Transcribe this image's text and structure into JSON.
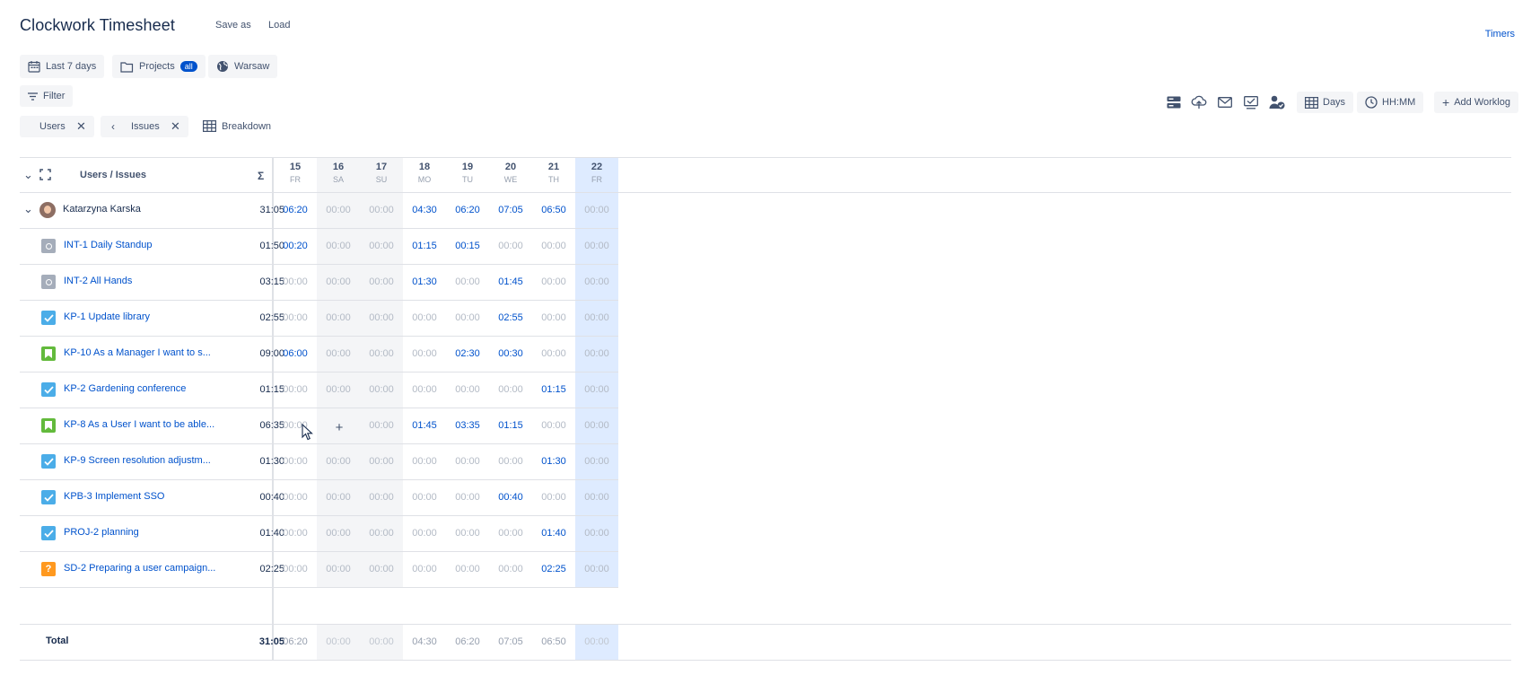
{
  "app": {
    "title": "Clockwork Timesheet",
    "save_as": "Save as",
    "load": "Load",
    "timers": "Timers"
  },
  "filters": {
    "period": "Last 7 days",
    "projects": "Projects",
    "projects_badge": "all",
    "timezone": "Warsaw",
    "filter": "Filter"
  },
  "grouping": {
    "users": "Users",
    "issues": "Issues",
    "breakdown": "Breakdown"
  },
  "toolbar": {
    "icons": [
      "server-icon",
      "cloud-upload-icon",
      "mail-icon",
      "report-icon",
      "user-check-icon"
    ],
    "days": "Days",
    "time_format": "HH:MM",
    "add_worklog": "Add Worklog"
  },
  "table": {
    "header": {
      "label": "Users / Issues",
      "sigma": "Σ"
    },
    "days": [
      {
        "num": "15",
        "dow": "FR"
      },
      {
        "num": "16",
        "dow": "SA"
      },
      {
        "num": "17",
        "dow": "SU"
      },
      {
        "num": "18",
        "dow": "MO"
      },
      {
        "num": "19",
        "dow": "TU"
      },
      {
        "num": "20",
        "dow": "WE"
      },
      {
        "num": "21",
        "dow": "TH"
      },
      {
        "num": "22",
        "dow": "FR"
      }
    ],
    "weekend_days": [
      1,
      2
    ],
    "today_day": 7,
    "user": {
      "name": "Katarzyna Karska",
      "total": "31:05",
      "values": [
        "06:20",
        "00:00",
        "00:00",
        "04:30",
        "06:20",
        "07:05",
        "06:50",
        "00:00"
      ]
    },
    "issues": [
      {
        "type": "task-gray",
        "label": "INT-1 Daily Standup",
        "total": "01:50",
        "values": [
          "00:20",
          "00:00",
          "00:00",
          "01:15",
          "00:15",
          "00:00",
          "00:00",
          "00:00"
        ]
      },
      {
        "type": "task-gray",
        "label": "INT-2 All Hands",
        "total": "03:15",
        "values": [
          "00:00",
          "00:00",
          "00:00",
          "01:30",
          "00:00",
          "01:45",
          "00:00",
          "00:00"
        ]
      },
      {
        "type": "task-blue",
        "label": "KP-1 Update library",
        "total": "02:55",
        "values": [
          "00:00",
          "00:00",
          "00:00",
          "00:00",
          "00:00",
          "02:55",
          "00:00",
          "00:00"
        ]
      },
      {
        "type": "story",
        "label": "KP-10 As a Manager I want to s...",
        "total": "09:00",
        "values": [
          "06:00",
          "00:00",
          "00:00",
          "00:00",
          "02:30",
          "00:30",
          "00:00",
          "00:00"
        ]
      },
      {
        "type": "task-blue",
        "label": "KP-2 Gardening conference",
        "total": "01:15",
        "values": [
          "00:00",
          "00:00",
          "00:00",
          "00:00",
          "00:00",
          "00:00",
          "01:15",
          "00:00"
        ]
      },
      {
        "type": "story",
        "label": "KP-8 As a User I want to be able...",
        "total": "06:35",
        "values": [
          "00:00",
          "",
          "00:00",
          "01:45",
          "03:35",
          "01:15",
          "00:00",
          "00:00"
        ]
      },
      {
        "type": "task-blue",
        "label": "KP-9 Screen resolution adjustm...",
        "total": "01:30",
        "values": [
          "00:00",
          "00:00",
          "00:00",
          "00:00",
          "00:00",
          "00:00",
          "01:30",
          "00:00"
        ]
      },
      {
        "type": "task-blue",
        "label": "KPB-3 Implement SSO",
        "total": "00:40",
        "values": [
          "00:00",
          "00:00",
          "00:00",
          "00:00",
          "00:00",
          "00:40",
          "00:00",
          "00:00"
        ]
      },
      {
        "type": "task-blue",
        "label": "PROJ-2 planning",
        "total": "01:40",
        "values": [
          "00:00",
          "00:00",
          "00:00",
          "00:00",
          "00:00",
          "00:00",
          "01:40",
          "00:00"
        ]
      },
      {
        "type": "question",
        "label": "SD-2 Preparing a user campaign...",
        "total": "02:25",
        "values": [
          "00:00",
          "00:00",
          "00:00",
          "00:00",
          "00:00",
          "00:00",
          "02:25",
          "00:00"
        ]
      }
    ],
    "footer": {
      "label": "Total",
      "total": "31:05",
      "values": [
        "06:20",
        "00:00",
        "00:00",
        "04:30",
        "06:20",
        "07:05",
        "06:50",
        "00:00"
      ]
    }
  },
  "colors": {
    "accent": "#0052cc",
    "muted": "#b3bac5",
    "weekend": "#f4f5f7",
    "today": "#deebff",
    "task_blue": "#4bade8",
    "task_gray": "#a5adba",
    "story": "#63ba3c",
    "question": "#ff991f"
  }
}
